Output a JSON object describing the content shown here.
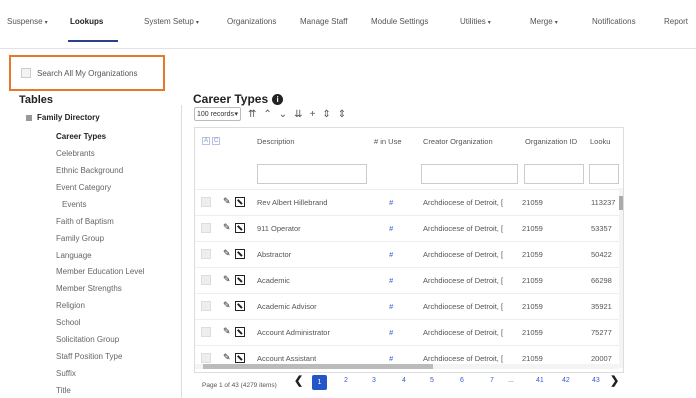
{
  "nav": {
    "items": [
      "Suspense",
      "Lookups",
      "System Setup",
      "Organizations",
      "Manage Staff",
      "Module Settings",
      "Utilities",
      "Merge",
      "Notifications",
      "Report"
    ],
    "active": "Lookups",
    "dropdown_caret": "▾"
  },
  "search_all": {
    "label": "Search All My Organizations",
    "checked": false
  },
  "sidebar": {
    "title": "Tables",
    "parent": "Family Directory",
    "items": [
      "Career Types",
      "Celebrants",
      "Ethnic Background",
      "Event Category",
      "Events",
      "Faith of Baptism",
      "Family Group",
      "Language",
      "Member Education Level",
      "Member Strengths",
      "Religion",
      "School",
      "Solicitation Group",
      "Staff Position Type",
      "Suffix",
      "Title"
    ],
    "selected": "Career Types"
  },
  "main": {
    "title": "Career Types",
    "info_icon": "info-icon",
    "records_select": "100 records",
    "toolbar_icons": [
      "double-up-icon",
      "up-icon",
      "down-icon",
      "double-down-icon",
      "plus-icon",
      "sort-icon",
      "sort-alt-icon"
    ],
    "ac_labels": [
      "A",
      "C"
    ],
    "headers": [
      "Description",
      "# in Use",
      "Creator Organization",
      "Organization ID",
      "Looku"
    ],
    "rows": [
      [
        "Rev Albert Hillebrand",
        "#",
        "Archdiocese of Detroit, [",
        "21059",
        "113237"
      ],
      [
        "911 Operator",
        "#",
        "Archdiocese of Detroit, [",
        "21059",
        "53357"
      ],
      [
        "Abstractor",
        "#",
        "Archdiocese of Detroit, [",
        "21059",
        "50422"
      ],
      [
        "Academic",
        "#",
        "Archdiocese of Detroit, [",
        "21059",
        "66298"
      ],
      [
        "Academic Advisor",
        "#",
        "Archdiocese of Detroit, [",
        "21059",
        "35921"
      ],
      [
        "Account Administrator",
        "#",
        "Archdiocese of Detroit, [",
        "21059",
        "75277"
      ],
      [
        "Account Assistant",
        "#",
        "Archdiocese of Detroit, [",
        "21059",
        "20007"
      ]
    ]
  },
  "pager": {
    "summary": "Page 1 of 43 (4279 items)",
    "pages": [
      "1",
      "2",
      "3",
      "4",
      "5",
      "6",
      "7",
      "...",
      "41",
      "42",
      "43"
    ],
    "current": "1",
    "prev": "❮",
    "next": "❯"
  },
  "colors": {
    "accent": "#2456c7",
    "highlight": "#e8762b",
    "link": "#3a5bcf"
  }
}
